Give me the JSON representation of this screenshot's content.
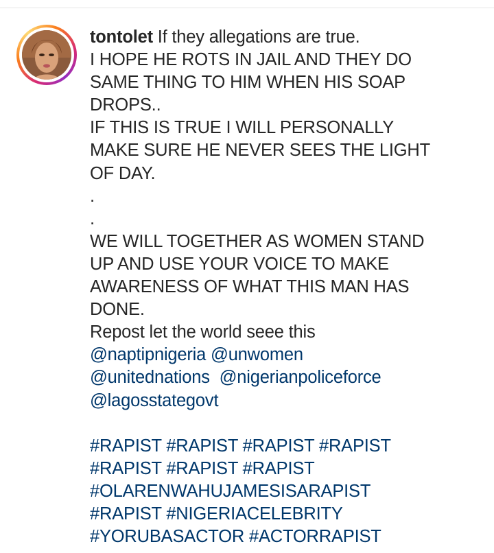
{
  "post": {
    "username": "tontolet",
    "caption_lines": [
      "If they allegations are true.",
      "I HOPE HE ROTS IN JAIL AND THEY DO",
      "SAME THING TO HIM WHEN HIS SOAP",
      "DROPS..",
      "IF THIS IS TRUE I WILL PERSONALLY",
      "MAKE SURE HE NEVER SEES THE LIGHT",
      "OF DAY.",
      ".",
      ".",
      "WE WILL TOGETHER AS WOMEN STAND",
      "UP AND USE YOUR VOICE TO MAKE",
      "AWARENESS OF WHAT THIS MAN HAS",
      "DONE.",
      "Repost let the world seee this"
    ],
    "mentions": [
      [
        "@naptipnigeria",
        "@unwomen"
      ],
      [
        "@unitednations",
        "@nigerianpoliceforce"
      ],
      [
        "@lagosstategovt"
      ]
    ],
    "hashtags": [
      [
        "#RAPIST",
        "#RAPIST",
        "#RAPIST",
        "#RAPIST"
      ],
      [
        "#RAPIST",
        "#RAPIST",
        "#RAPIST"
      ],
      [
        "#OLARENWAHUJAMESISARAPIST"
      ],
      [
        "#RAPIST",
        "#NIGERIACELEBRITY"
      ],
      [
        "#YORUBASACTOR",
        "#ACTORRAPIST"
      ]
    ]
  },
  "colors": {
    "text": "#262626",
    "link": "#00376b",
    "story_ring_start": "#d62976",
    "story_ring_mid": "#fa7e1e",
    "story_ring_end": "#feda75"
  },
  "icons": {
    "avatar": "profile-photo"
  }
}
